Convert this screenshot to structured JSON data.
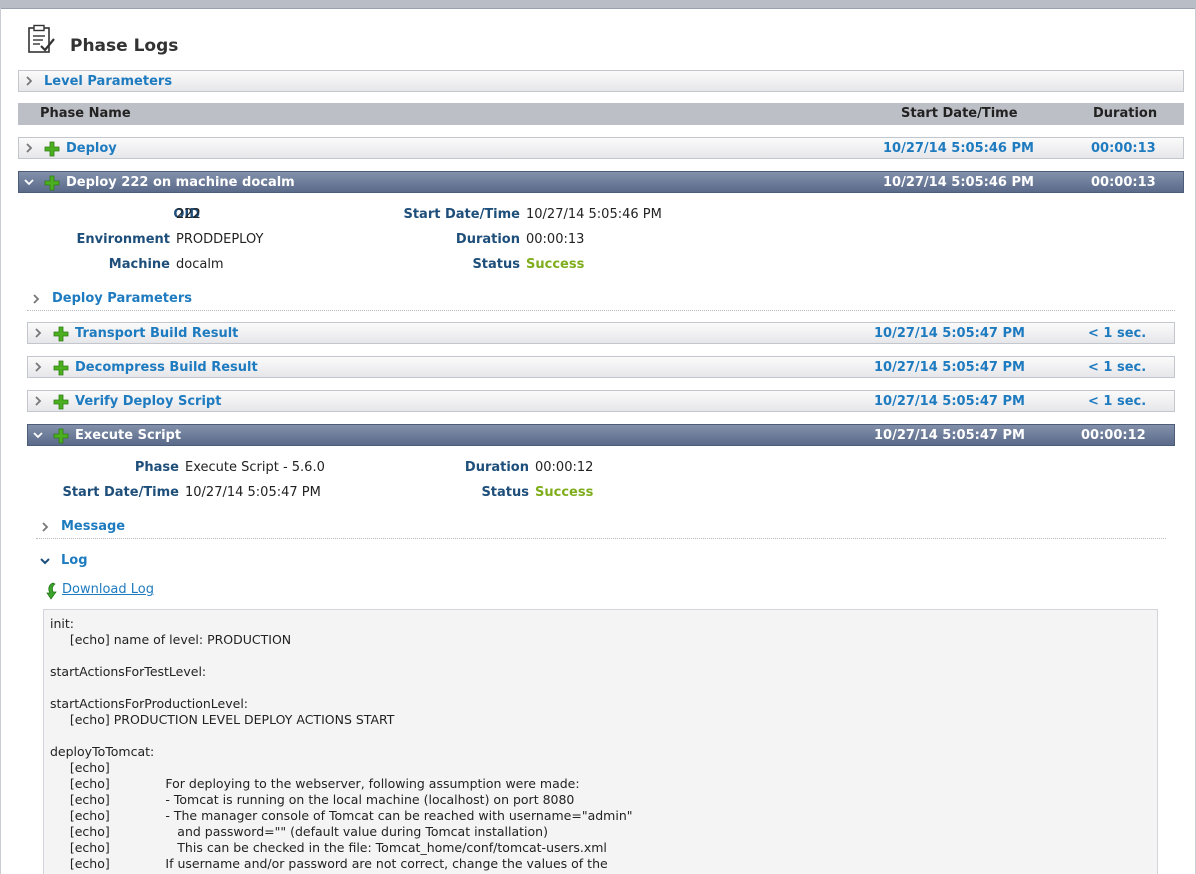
{
  "page": {
    "title": "Phase Logs",
    "icon": "checklist-icon"
  },
  "level_parameters": {
    "label": "Level Parameters"
  },
  "table_header": {
    "phase_name": "Phase Name",
    "start": "Start Date/Time",
    "duration": "Duration"
  },
  "deploy": {
    "label": "Deploy",
    "start": "10/27/14 5:05:46 PM",
    "duration": "00:00:13"
  },
  "deploy222": {
    "label": "Deploy 222 on machine docalm",
    "start": "10/27/14 5:05:46 PM",
    "duration": "00:00:13",
    "fields": {
      "oid_label": "OID",
      "oid": "222",
      "env_label": "Environment",
      "env": "PRODDEPLOY",
      "machine_label": "Machine",
      "machine": "docalm",
      "start_label": "Start Date/Time",
      "start": "10/27/14 5:05:46 PM",
      "duration_label": "Duration",
      "duration": "00:00:13",
      "status_label": "Status",
      "status": "Success"
    },
    "deploy_parameters": "Deploy Parameters",
    "subphases": [
      {
        "label": "Transport Build Result",
        "start": "10/27/14 5:05:47 PM",
        "duration": "< 1 sec."
      },
      {
        "label": "Decompress Build Result",
        "start": "10/27/14 5:05:47 PM",
        "duration": "< 1 sec."
      },
      {
        "label": "Verify Deploy Script",
        "start": "10/27/14 5:05:47 PM",
        "duration": "< 1 sec."
      }
    ]
  },
  "execute": {
    "label": "Execute Script",
    "start": "10/27/14 5:05:47 PM",
    "duration": "00:00:12",
    "fields": {
      "phase_label": "Phase",
      "phase": "Execute Script - 5.6.0",
      "start_label": "Start Date/Time",
      "start": "10/27/14 5:05:47 PM",
      "duration_label": "Duration",
      "duration": "00:00:12",
      "status_label": "Status",
      "status": "Success"
    },
    "message_label": "Message",
    "log_label": "Log",
    "download_label": " Download Log",
    "log_lines": [
      "init:",
      "     [echo] name of level: PRODUCTION",
      "",
      "startActionsForTestLevel:",
      "",
      "startActionsForProductionLevel:",
      "     [echo] PRODUCTION LEVEL DEPLOY ACTIONS START",
      "",
      "deployToTomcat:",
      "     [echo]",
      "     [echo]              For deploying to the webserver, following assumption were made:",
      "     [echo]              - Tomcat is running on the local machine (localhost) on port 8080",
      "     [echo]              - The manager console of Tomcat can be reached with username=\"admin\"",
      "     [echo]                 and password=\"\" (default value during Tomcat installation)",
      "     [echo]                 This can be checked in the file: Tomcat_home/conf/tomcat-users.xml",
      "     [echo]              If username and/or password are not correct, change the values of the"
    ]
  }
}
